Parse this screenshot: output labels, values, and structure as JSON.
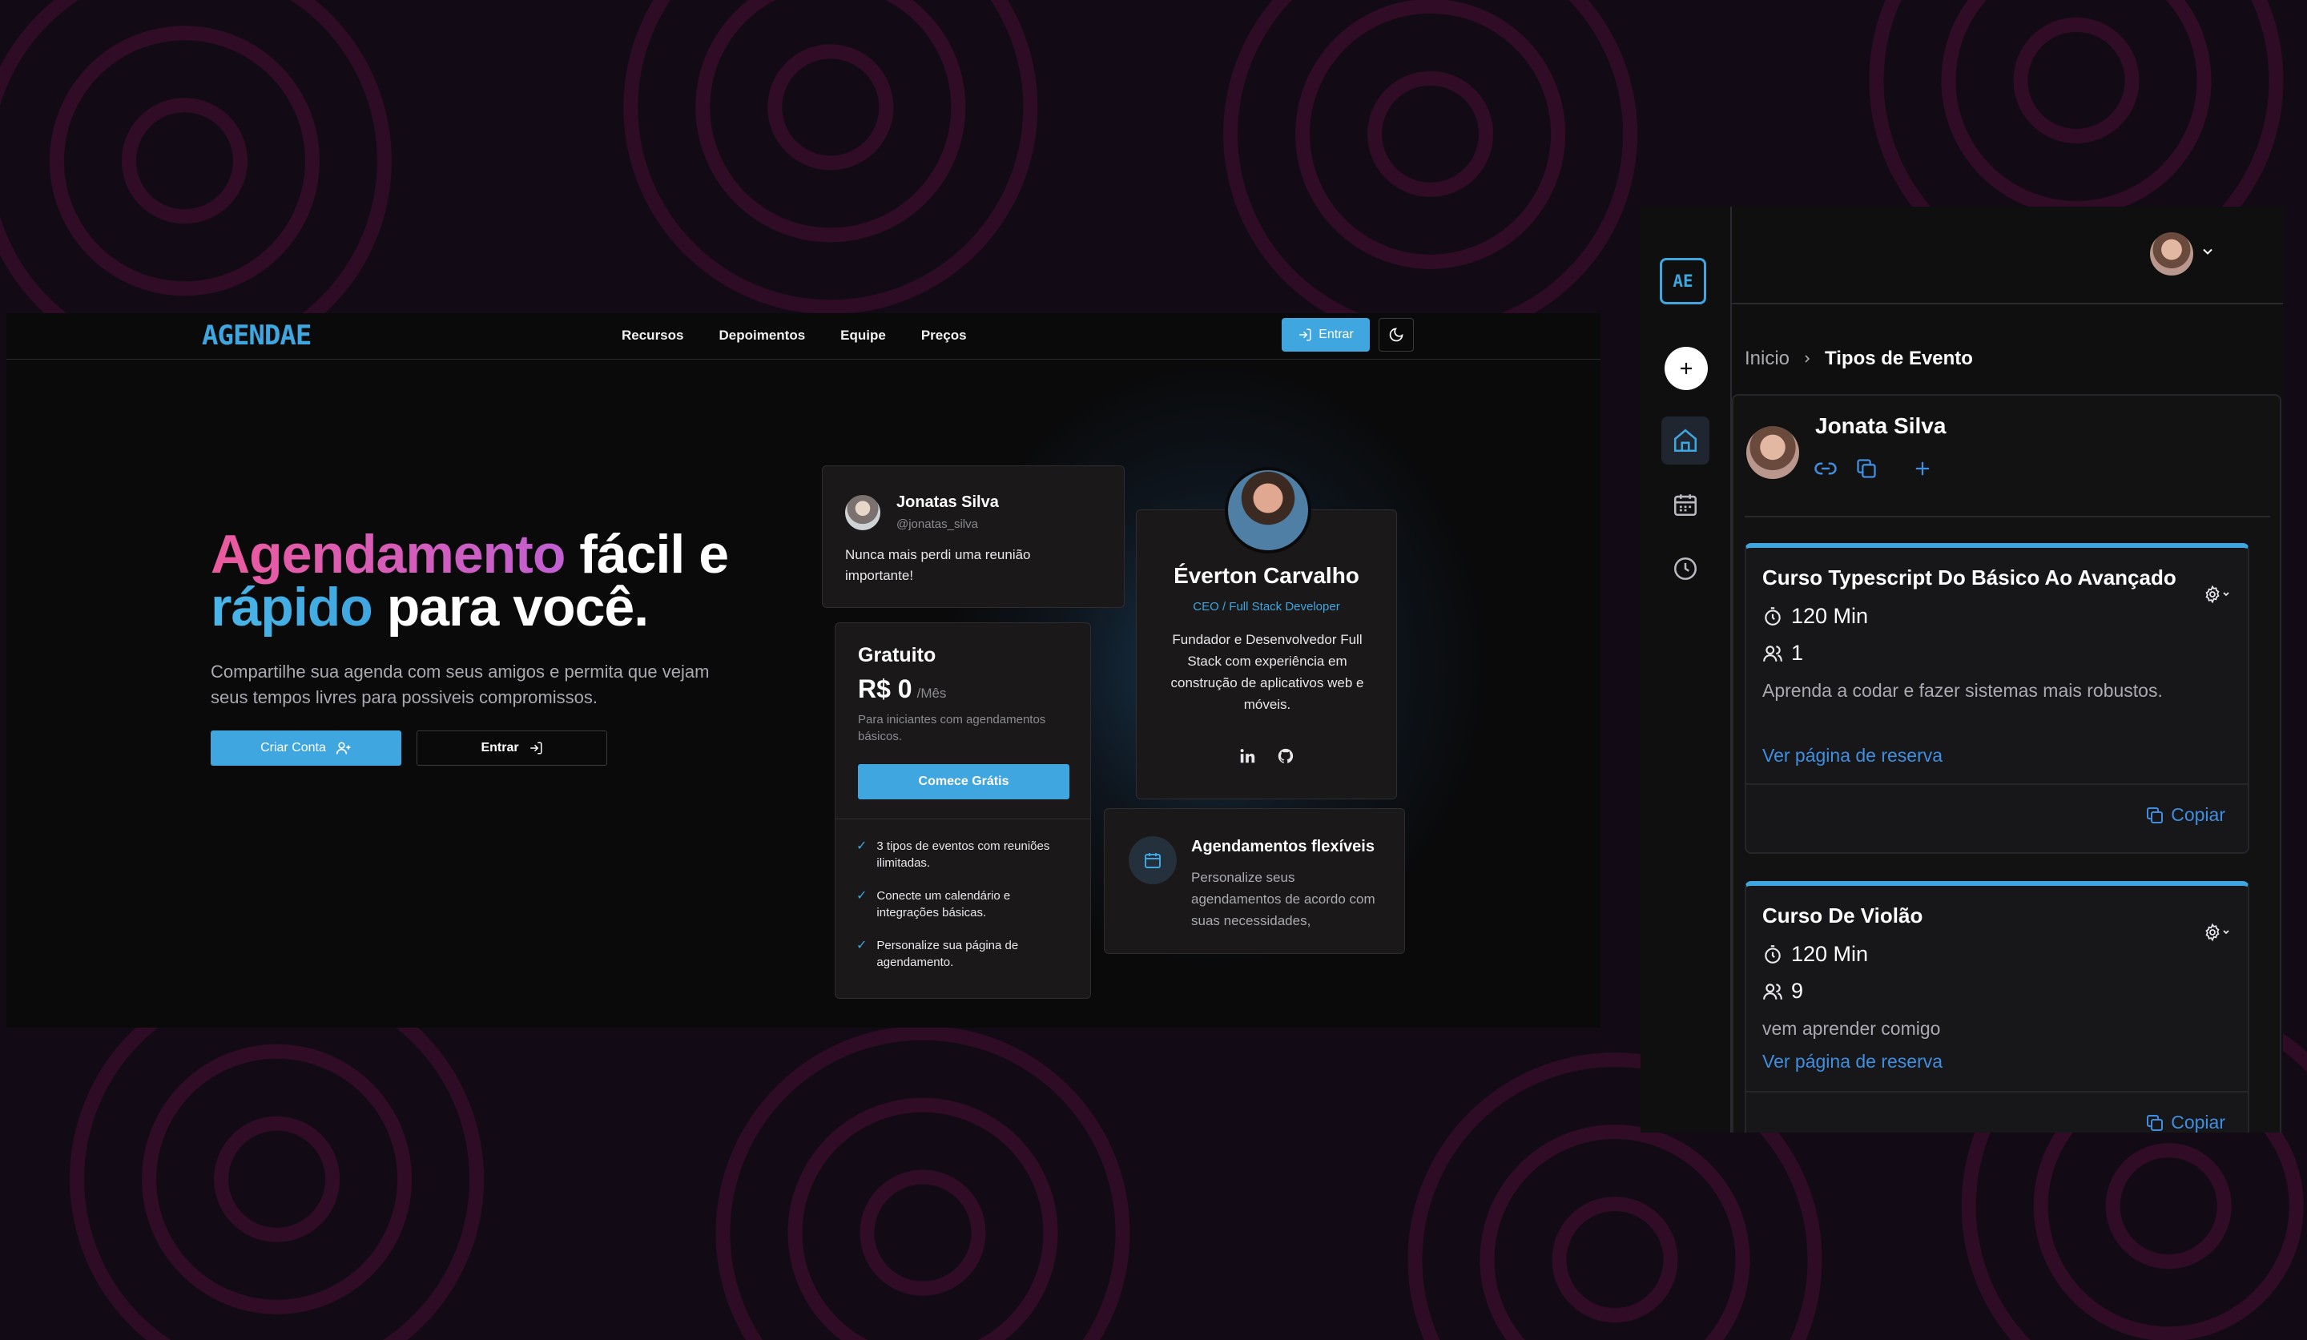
{
  "landing": {
    "logo": "AGENDAE",
    "nav": [
      "Recursos",
      "Depoimentos",
      "Equipe",
      "Preços"
    ],
    "entrar_top": "Entrar",
    "hero": {
      "t1a": "Agendamento",
      "t1b": " fácil e",
      "t2a": "rápido",
      "t2b": " para você.",
      "subtitle": "Compartilhe sua agenda com seus amigos e permita que vejam seus tempos livres para possiveis compromissos.",
      "criar_conta": "Criar Conta",
      "entrar": "Entrar"
    },
    "testimonial": {
      "name": "Jonatas Silva",
      "handle": "@jonatas_silva",
      "text": "Nunca mais perdi uma reunião importante!"
    },
    "pricing": {
      "title": "Gratuito",
      "price": "R$ 0",
      "period": "/Mês",
      "desc": "Para iniciantes com agendamentos básicos.",
      "cta": "Comece Grátis",
      "features": [
        "3 tipos de eventos com reuniões ilimitadas.",
        "Conecte um calendário e integrações básicas.",
        "Personalize sua página de agendamento."
      ]
    },
    "team": {
      "name": "Éverton Carvalho",
      "role": "CEO / Full Stack Developer",
      "bio": "Fundador e Desenvolvedor Full Stack com experiência em construção de aplicativos web e móveis."
    },
    "feature": {
      "title": "Agendamentos flexíveis",
      "text": "Personalize seus agendamentos de acordo com suas necessidades,"
    }
  },
  "app": {
    "logo": "AE",
    "breadcrumb": [
      "Inicio",
      "Tipos de Evento"
    ],
    "profile_name": "Jonata Silva",
    "events": [
      {
        "title": "Curso Typescript Do Básico Ao Avançado",
        "duration": "120 Min",
        "attendees": "1",
        "description": "Aprenda a codar e fazer sistemas mais robustos.",
        "link": "Ver página de reserva",
        "copy": "Copiar"
      },
      {
        "title": "Curso De Violão",
        "duration": "120 Min",
        "attendees": "9",
        "description": "vem aprender comigo",
        "link": "Ver página de reserva",
        "copy": "Copiar"
      }
    ]
  },
  "colors": {
    "accent": "#3fa6df",
    "link": "#3f8ee0",
    "pink": "#ec5a9d"
  }
}
